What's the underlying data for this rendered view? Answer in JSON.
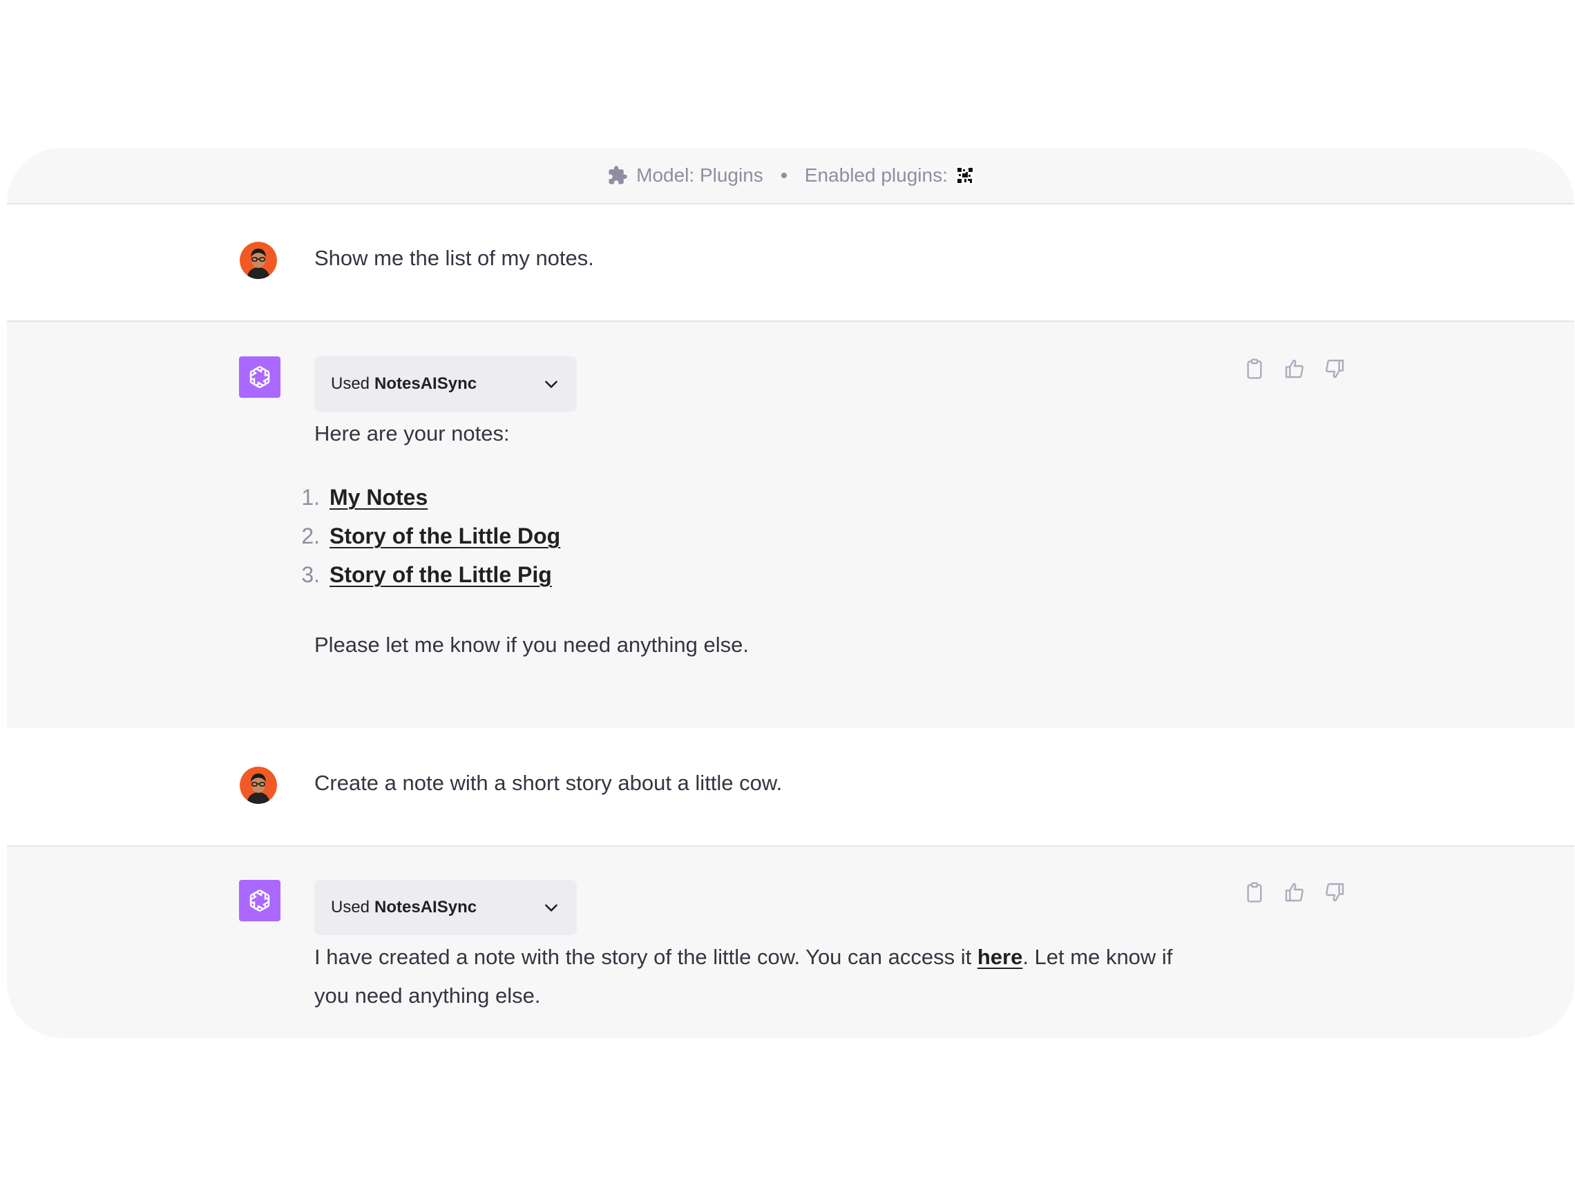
{
  "header": {
    "model_label": "Model: Plugins",
    "enabled_label": "Enabled plugins:",
    "model_icon": "puzzle-icon",
    "plugin_icon": "notesaisync-plugin-icon"
  },
  "conversation": [
    {
      "role": "user",
      "text": "Show me the list of my notes."
    },
    {
      "role": "assistant",
      "plugin": {
        "used": "Used",
        "name": "NotesAISync"
      },
      "intro": "Here are your notes:",
      "list": [
        {
          "num": "1.",
          "label": "My Notes"
        },
        {
          "num": "2.",
          "label": "Story of the Little Dog"
        },
        {
          "num": "3.",
          "label": "Story of the Little Pig"
        }
      ],
      "outro": "Please let me know if you need anything else."
    },
    {
      "role": "user",
      "text": "Create a note with a short story about a little cow."
    },
    {
      "role": "assistant",
      "plugin": {
        "used": "Used",
        "name": "NotesAISync"
      },
      "text_before": "I have created a note with the story of the little cow. You can access it ",
      "link": "here",
      "text_after": ". Let me know if",
      "text_line2": "you need anything else."
    }
  ],
  "colors": {
    "bot_avatar": "#ab68ff",
    "bot_row_bg": "#f7f7f8",
    "user_avatar_bg": "#f15a24"
  }
}
